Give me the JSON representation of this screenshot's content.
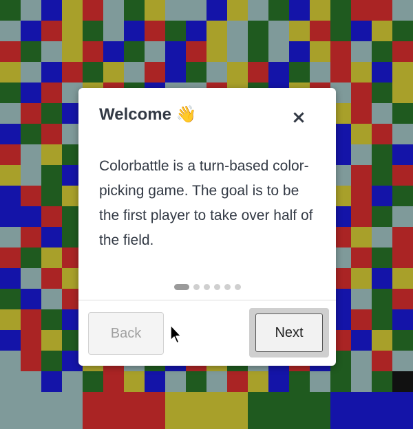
{
  "modal": {
    "title": "Welcome 👋",
    "close_label": "×",
    "body": "Colorbattle is a turn-based color-picking game. The goal is to be the first player to take over half of the field.",
    "steps_total": 6,
    "current_step": 1,
    "back_label": "Back",
    "next_label": "Next"
  },
  "board": {
    "colors": {
      "r": "#aa2424",
      "b": "#1414a8",
      "y": "#a8a02a",
      "g": "#1f5a1f",
      "s": "#7f9a9a",
      "k": "#111111"
    },
    "rows": [
      "gsbyrsgyssbysgbygrrs",
      "sbrygsbrgbysgsyrgbyg",
      "rgsyrbgsbrysgsbyrsgr",
      "ysbrgysrbgsyrbgsryby",
      "gbrsyrgbssrygbyrsrgy",
      "srgbyrsggbyrsbgbyrsg",
      "bgrsybrssbgyrgbsbyrs",
      "rsyggbrsrbsyggrbbsgb",
      "ysgbrgssyrbgrsrbsrgr",
      "brgysrbsgysbrgsbyrbg",
      "bbrgyrsbrgysbrgsbrgs",
      "srbgrysrgbsyrsgbrysr",
      "rgyrsbrgbrygsbrbsrgr",
      "bsryrgsbgyrgbsrsryby",
      "gbsrygrbsgbrysgrbsgr",
      "yrgbsrbgyrsgbrysbrgb",
      "bryggrbsrbysgrsgrbyg",
      "srgbyrsgbrygsbrbgsrs",
      "ssbsgrybsgsrybgsgsgk"
    ],
    "bottom_blocks": [
      "s",
      "s",
      "r",
      "r",
      "y",
      "y",
      "g",
      "g",
      "b",
      "b"
    ]
  }
}
